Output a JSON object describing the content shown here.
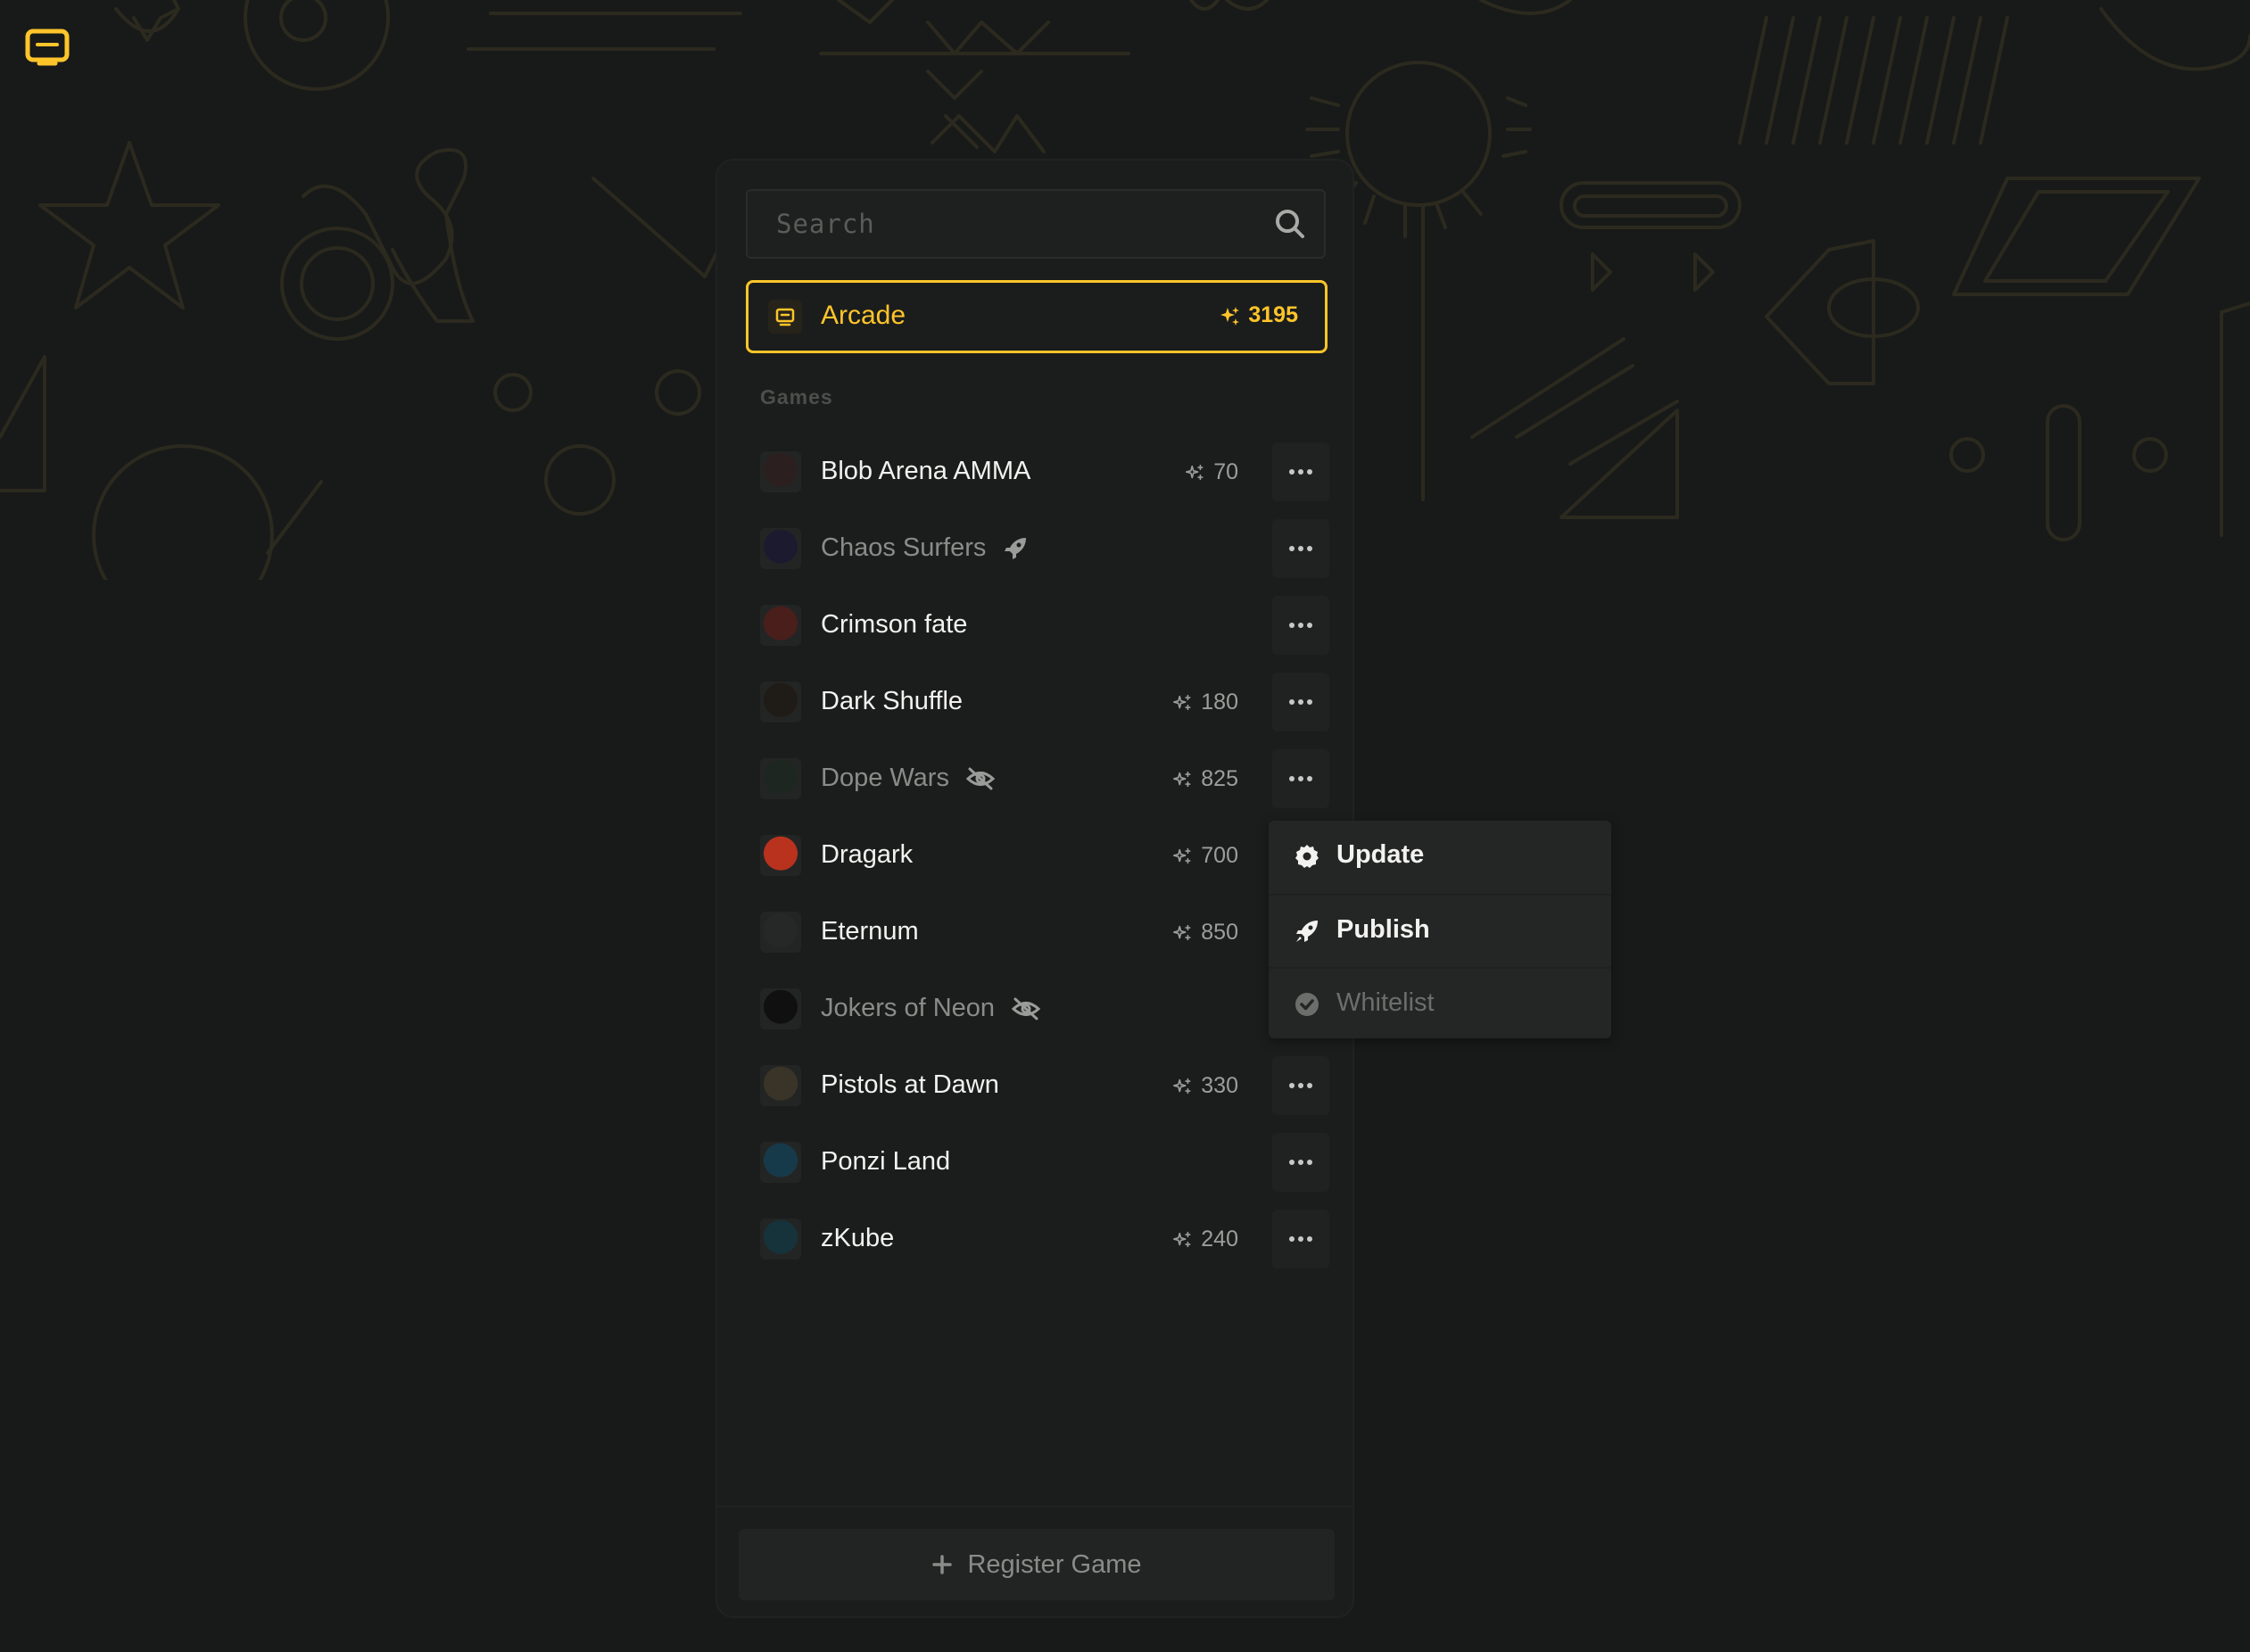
{
  "search": {
    "placeholder": "Search",
    "value": ""
  },
  "arcade": {
    "label": "Arcade",
    "points": "3195",
    "icon": "arcade-icon",
    "accent": "#ffc52a"
  },
  "games_section": {
    "title": "Games"
  },
  "games": [
    {
      "name": "Blob Arena AMMA",
      "points": "70",
      "status": null,
      "has_menu": true,
      "thumb_color": "#2b1f1f"
    },
    {
      "name": "Chaos Surfers",
      "points": null,
      "status": "rocket-icon",
      "has_menu": true,
      "dim": true,
      "thumb_color": "#1c1a2e"
    },
    {
      "name": "Crimson fate",
      "points": null,
      "status": null,
      "has_menu": true,
      "thumb_color": "#4a1e1a"
    },
    {
      "name": "Dark Shuffle",
      "points": "180",
      "status": null,
      "has_menu": true,
      "thumb_color": "#1f1b17"
    },
    {
      "name": "Dope Wars",
      "points": "825",
      "status": "eye-off-icon",
      "has_menu": true,
      "dim": true,
      "thumb_color": "#1d2620"
    },
    {
      "name": "Dragark",
      "points": "700",
      "status": null,
      "has_menu": false,
      "thumb_color": "#b8321e"
    },
    {
      "name": "Eternum",
      "points": "850",
      "status": null,
      "has_menu": false,
      "thumb_color": "#262827"
    },
    {
      "name": "Jokers of Neon",
      "points": null,
      "status": "eye-off-icon",
      "has_menu": false,
      "dim": true,
      "thumb_color": "#101010"
    },
    {
      "name": "Pistols at Dawn",
      "points": "330",
      "status": null,
      "has_menu": true,
      "thumb_color": "#3a3428"
    },
    {
      "name": "Ponzi Land",
      "points": null,
      "status": null,
      "has_menu": true,
      "thumb_color": "#173a4a"
    },
    {
      "name": "zKube",
      "points": "240",
      "status": null,
      "has_menu": true,
      "thumb_color": "#16323a"
    }
  ],
  "context_menu": {
    "items": [
      {
        "label": "Update",
        "icon": "gear-icon",
        "enabled": true
      },
      {
        "label": "Publish",
        "icon": "rocket-icon",
        "enabled": true
      },
      {
        "label": "Whitelist",
        "icon": "check-circle-icon",
        "enabled": false
      }
    ]
  },
  "register_button": {
    "label": "Register Game",
    "icon": "plus-icon"
  },
  "colors": {
    "background": "#181a19",
    "accent": "#ffc52a",
    "panel": "#1b1d1c"
  }
}
